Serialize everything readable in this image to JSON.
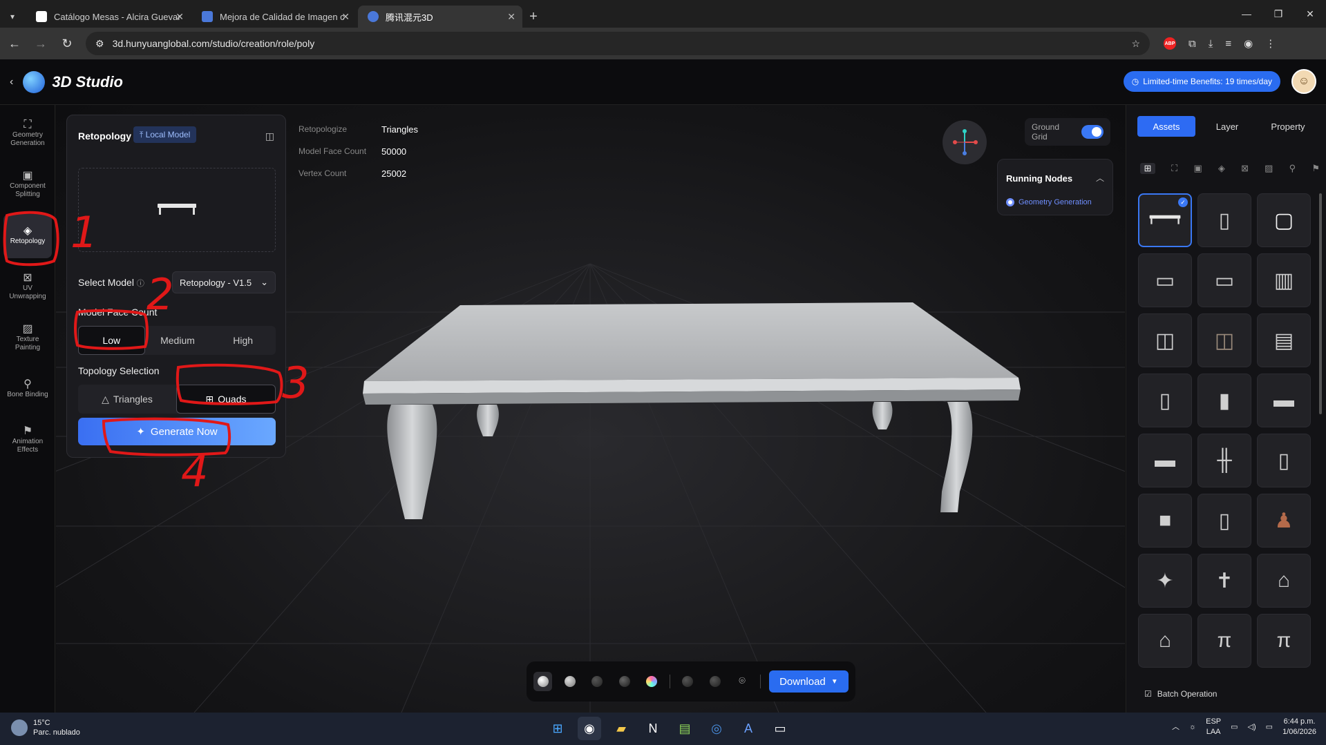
{
  "browser": {
    "tabs": [
      {
        "title": "Catálogo Mesas - Alcira Guevar"
      },
      {
        "title": "Mejora de Calidad de Imagen c"
      },
      {
        "title": "腾讯混元3D"
      }
    ],
    "url": "3d.hunyuanglobal.com/studio/creation/role/poly"
  },
  "app": {
    "brand": "3D Studio",
    "benefit": "Limited-time Benefits: 19 times/day"
  },
  "sidebar": {
    "items": [
      {
        "label": "Geometry Generation",
        "icon": "cube-person-icon"
      },
      {
        "label": "Component Splitting",
        "icon": "split-icon"
      },
      {
        "label": "Retopology",
        "icon": "retopology-icon",
        "active": true
      },
      {
        "label": "UV Unwrapping",
        "icon": "uv-icon"
      },
      {
        "label": "Texture Painting",
        "icon": "brush-icon"
      },
      {
        "label": "Bone Binding",
        "icon": "bone-icon"
      },
      {
        "label": "Animation Effects",
        "icon": "run-icon"
      }
    ]
  },
  "panel": {
    "title": "Retopology",
    "local_model": "Local Model",
    "select_model_label": "Select Model",
    "select_model_value": "Retopology - V1.5",
    "face_count_label": "Model Face Count",
    "face_counts": [
      "Low",
      "Medium",
      "High"
    ],
    "face_count_selected": "Low",
    "topology_label": "Topology Selection",
    "topologies": [
      "Triangles",
      "Quads"
    ],
    "topology_selected": "Quads",
    "generate": "Generate Now"
  },
  "stats": {
    "retopo_label": "Retopologize",
    "retopo_value": "Triangles",
    "faces_label": "Model Face Count",
    "faces_value": "50000",
    "verts_label": "Vertex Count",
    "verts_value": "25002"
  },
  "viewport": {
    "ground_grid": "Ground Grid",
    "ground_grid_on": true,
    "running_nodes": "Running Nodes",
    "running_node_item": "Geometry Generation",
    "download": "Download"
  },
  "right_panel": {
    "tabs": [
      "Assets",
      "Layer",
      "Property"
    ],
    "active_tab": "Assets",
    "batch": "Batch Operation"
  },
  "annotations": [
    "1",
    "2",
    "3",
    "4"
  ],
  "taskbar": {
    "temp": "15°C",
    "weather": "Parc. nublado",
    "lang1": "ESP",
    "lang2": "LAA",
    "time": "6:44 p.m.",
    "date": "1/06/2026"
  }
}
